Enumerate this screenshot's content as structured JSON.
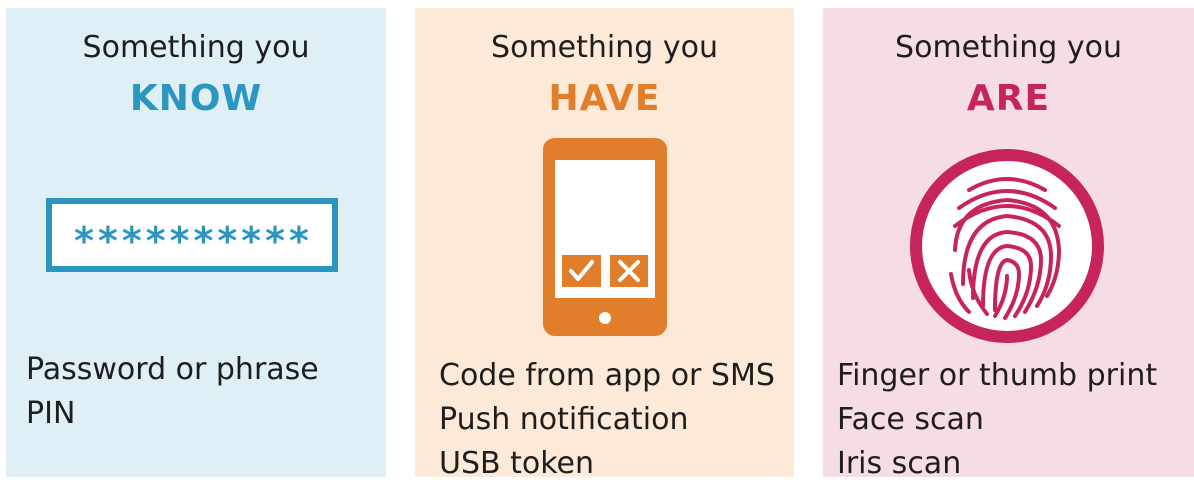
{
  "factors": [
    {
      "intro": "Something you",
      "keyword": "KNOW",
      "password_mask": "**********",
      "items": [
        "Password or phrase",
        "PIN"
      ]
    },
    {
      "intro": "Something you",
      "keyword": "HAVE",
      "items": [
        "Code from app or SMS",
        "Push notification",
        "USB token"
      ]
    },
    {
      "intro": "Something you",
      "keyword": "ARE",
      "items": [
        "Finger or thumb print",
        "Face scan",
        "Iris scan"
      ]
    }
  ],
  "colors": {
    "know_accent": "#2b97c1",
    "know_bg": "#dfeff6",
    "have_accent": "#e07e2c",
    "have_bg": "#fde9d8",
    "are_accent": "#c7245a",
    "are_bg": "#f5dde3"
  },
  "icons": [
    "password-field-icon",
    "smartphone-icon",
    "fingerprint-icon"
  ]
}
